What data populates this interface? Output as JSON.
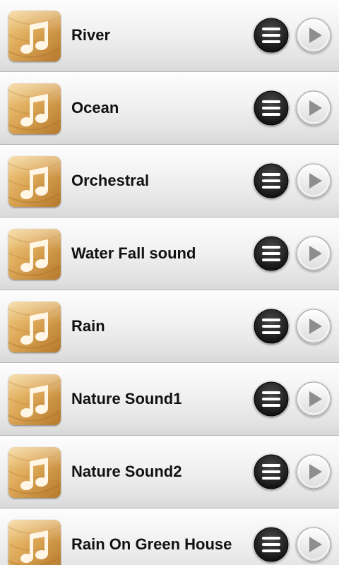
{
  "tracks": [
    {
      "title": "River"
    },
    {
      "title": "Ocean"
    },
    {
      "title": "Orchestral"
    },
    {
      "title": "Water Fall sound"
    },
    {
      "title": "Rain"
    },
    {
      "title": "Nature Sound1"
    },
    {
      "title": "Nature Sound2"
    },
    {
      "title": "Rain On Green House"
    }
  ],
  "icons": {
    "album": "music-note-icon",
    "menu": "menu-icon",
    "play": "play-icon"
  },
  "colors": {
    "row_bg": "#efefef",
    "title_text": "#111111",
    "menu_button": "#222222",
    "play_button": "#f2f2f2",
    "album_gold": "#d9a44a"
  }
}
